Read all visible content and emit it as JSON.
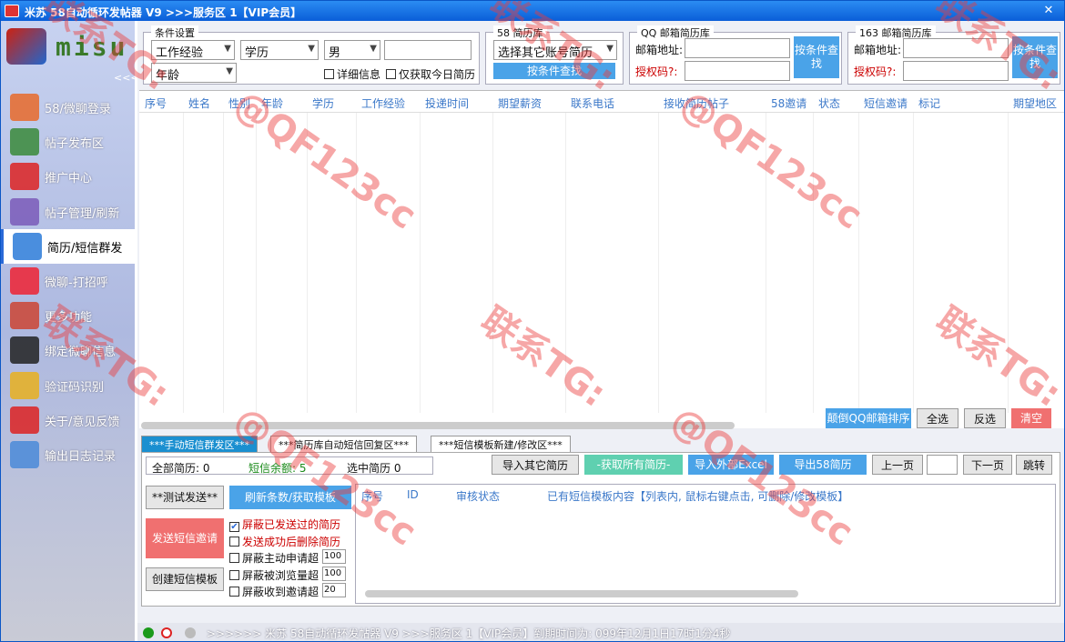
{
  "window": {
    "title": "米苏 58自动循环发帖器 V9 >>>服务区 1【VIP会员】",
    "close": "✕"
  },
  "sidebar": {
    "logo_text": "misu",
    "collapse": "<<<",
    "items": [
      {
        "label": "58/微聊登录",
        "icon": "code-window-icon",
        "color": "#e86a2a"
      },
      {
        "label": "帖子发布区",
        "icon": "paint-brush-icon",
        "color": "#3a8a3a"
      },
      {
        "label": "推广中心",
        "icon": "bar-chart-icon",
        "color": "#d22"
      },
      {
        "label": "帖子管理/刷新",
        "icon": "checklist-icon",
        "color": "#7a5ab8"
      },
      {
        "label": "简历/短信群发",
        "icon": "envelope-icon",
        "color": "#2a7ad8"
      },
      {
        "label": "微聊-打招呼",
        "icon": "chat-bubbles-icon",
        "color": "#e23"
      },
      {
        "label": "更多功能",
        "icon": "tools-icon",
        "color": "#c43"
      },
      {
        "label": "绑定微聊信息",
        "icon": "cat-mascot-icon",
        "color": "#222"
      },
      {
        "label": "验证码识别",
        "icon": "lightbulb-icon",
        "color": "#e8b020"
      },
      {
        "label": "关于/意见反馈",
        "icon": "info-icon",
        "color": "#d22"
      },
      {
        "label": "输出日志记录",
        "icon": "log-book-icon",
        "color": "#4a8ad8"
      }
    ]
  },
  "conditions": {
    "title": "条件设置",
    "experience": "工作经验",
    "education": "学历",
    "gender": "男",
    "age": "年龄",
    "keyword": "",
    "detail_label": "详细信息",
    "today_label": "仅获取今日简历"
  },
  "lib58": {
    "title": "58 简历库",
    "select": "选择其它账号简历",
    "button": "按条件查找"
  },
  "libqq": {
    "title": "QQ 邮箱简历库",
    "email_label": "邮箱地址:",
    "auth_label": "授权码?:",
    "email": "",
    "auth": "",
    "button": "按条件查找"
  },
  "lib163": {
    "title": "163 邮箱简历库",
    "email_label": "邮箱地址:",
    "auth_label": "授权码?:",
    "email": "",
    "auth": "",
    "button": "按条件查找"
  },
  "table": {
    "columns": [
      "序号",
      "姓名",
      "性别",
      "年龄",
      "学历",
      "工作经验",
      "投递时间",
      "期望薪资",
      "联系电话",
      "接收简历帖子",
      "58邀请",
      "状态",
      "短信邀请",
      "标记",
      "期望地区"
    ]
  },
  "table_actions": {
    "reverse": "颠倒QQ邮箱排序",
    "select_all": "全选",
    "invert": "反选",
    "clear": "清空"
  },
  "tabs": [
    "***手动短信群发区***",
    "***简历库自动短信回复区***",
    "***短信模板新建/修改区***"
  ],
  "sms": {
    "all_resumes": "全部简历: 0",
    "balance": "短信余额: 5",
    "selected": "选中简历 0",
    "import_other": "导入其它简历",
    "fetch_all": "-获取所有简历-",
    "import_excel": "导入外部Excel",
    "export58": "导出58简历",
    "prev": "上一页",
    "page": "",
    "next": "下一页",
    "jump": "跳转",
    "test_send": "**测试发送**",
    "refresh": "刷新条数/获取模板",
    "send": "发送短信邀请",
    "create_template": "创建短信模板",
    "opts": [
      {
        "label": "屏蔽已发送过的简历",
        "checked": true,
        "red": true
      },
      {
        "label": "发送成功后删除简历",
        "checked": false,
        "red": true
      },
      {
        "label": "屏蔽主动申请超",
        "checked": false,
        "red": false,
        "value": "100"
      },
      {
        "label": "屏蔽被浏览量超",
        "checked": false,
        "red": false,
        "value": "100"
      },
      {
        "label": "屏蔽收到邀请超",
        "checked": false,
        "red": false,
        "value": "20"
      }
    ],
    "template_cols": [
      "序号",
      "ID",
      "审核状态",
      "已有短信模板内容【列表内, 鼠标右键点击, 可删除/修改模板】"
    ]
  },
  "status": {
    "text": ">>>>>> 米苏 58自动循环发帖器 V9 >>>服务区 1【VIP会员】到期时间为: 099年12月1日17时1分4秒"
  },
  "watermark": {
    "line1": "联系TG:",
    "line2": "@QF123cc"
  }
}
